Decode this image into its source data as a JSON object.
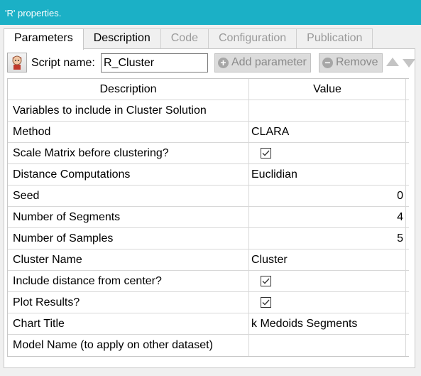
{
  "window": {
    "title": "'R' properties."
  },
  "tabs": [
    {
      "label": "Parameters",
      "state": "active"
    },
    {
      "label": "Description",
      "state": "normal"
    },
    {
      "label": "Code",
      "state": "disabled"
    },
    {
      "label": "Configuration",
      "state": "disabled"
    },
    {
      "label": "Publication",
      "state": "disabled"
    }
  ],
  "toolbar": {
    "script_name_label": "Script name:",
    "script_name_value": "R_Cluster",
    "add_parameter_label": "Add parameter",
    "remove_label": "Remove"
  },
  "table": {
    "headers": {
      "description": "Description",
      "value": "Value"
    },
    "rows": [
      {
        "description": "Variables to include in Cluster Solution",
        "value": "",
        "type": "text"
      },
      {
        "description": "Method",
        "value": "CLARA",
        "type": "text"
      },
      {
        "description": "Scale Matrix before clustering?",
        "value": "",
        "type": "checkbox",
        "checked": true
      },
      {
        "description": "Distance Computations",
        "value": "Euclidian",
        "type": "text"
      },
      {
        "description": "Seed",
        "value": "0",
        "type": "number"
      },
      {
        "description": "Number of Segments",
        "value": "4",
        "type": "number"
      },
      {
        "description": "Number of Samples",
        "value": "5",
        "type": "number"
      },
      {
        "description": "Cluster Name",
        "value": "Cluster",
        "type": "text"
      },
      {
        "description": "Include distance from center?",
        "value": "",
        "type": "checkbox",
        "checked": true
      },
      {
        "description": "Plot Results?",
        "value": "",
        "type": "checkbox",
        "checked": true
      },
      {
        "description": "Chart Title",
        "value": "k Medoids Segments",
        "type": "text"
      },
      {
        "description": "Model Name (to apply on other dataset)",
        "value": "",
        "type": "text"
      }
    ]
  },
  "colors": {
    "titlebar": "#1bb0c6",
    "panel_bg": "#ffffff",
    "window_bg": "#f0f0f0"
  },
  "icons": {
    "script": "r-script-icon",
    "add": "plus-circle-icon",
    "remove": "minus-circle-icon",
    "up": "arrow-up-icon",
    "down": "arrow-down-icon",
    "check": "checkbox-checked-icon"
  }
}
